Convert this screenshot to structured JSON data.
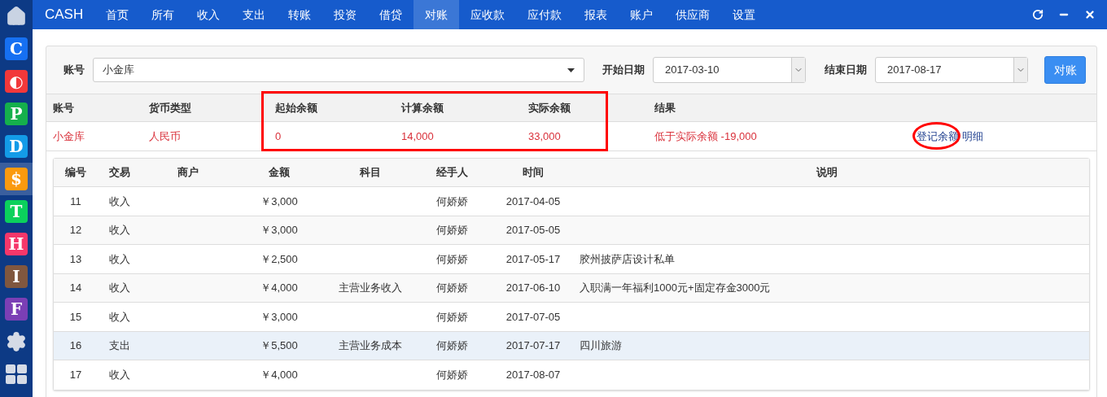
{
  "sidebar": {
    "items": [
      {
        "kind": "home",
        "selected": false
      },
      {
        "kind": "tile",
        "letter": "C",
        "color": "#1670f2",
        "selected": false
      },
      {
        "kind": "tile",
        "letter": "◐",
        "color": "#f2383a",
        "selected": false
      },
      {
        "kind": "tile",
        "letter": "P",
        "color": "#15b04c",
        "selected": false
      },
      {
        "kind": "tile",
        "letter": "D",
        "color": "#139be8",
        "selected": false
      },
      {
        "kind": "tile",
        "letter": "$",
        "color": "#fb9a0e",
        "selected": true
      },
      {
        "kind": "tile",
        "letter": "T",
        "color": "#0bd15c",
        "selected": false
      },
      {
        "kind": "tile",
        "letter": "H",
        "color": "#f5376a",
        "selected": false
      },
      {
        "kind": "tile",
        "letter": "I",
        "color": "#80573f",
        "selected": false
      },
      {
        "kind": "tile",
        "letter": "F",
        "color": "#7b3fb5",
        "selected": false
      },
      {
        "kind": "settings",
        "selected": false
      },
      {
        "kind": "apps",
        "selected": false
      }
    ]
  },
  "topbar": {
    "brand": "CASH",
    "tabs": [
      {
        "label": "首页",
        "selected": false
      },
      {
        "label": "所有",
        "selected": false
      },
      {
        "label": "收入",
        "selected": false
      },
      {
        "label": "支出",
        "selected": false
      },
      {
        "label": "转账",
        "selected": false
      },
      {
        "label": "投资",
        "selected": false
      },
      {
        "label": "借贷",
        "selected": false
      },
      {
        "label": "对账",
        "selected": true
      },
      {
        "label": "应收款",
        "selected": false
      },
      {
        "label": "应付款",
        "selected": false
      },
      {
        "label": "报表",
        "selected": false
      },
      {
        "label": "账户",
        "selected": false
      },
      {
        "label": "供应商",
        "selected": false
      },
      {
        "label": "设置",
        "selected": false
      }
    ]
  },
  "filter": {
    "account_label": "账号",
    "account": "小金库",
    "start_label": "开始日期",
    "start_date": "2017-03-10",
    "end_label": "结束日期",
    "end_date": "2017-08-17",
    "button": "对账"
  },
  "summary": {
    "columns": [
      "账号",
      "货币类型",
      "起始余额",
      "计算余额",
      "实际余额",
      "结果"
    ],
    "row": {
      "account": "小金库",
      "currency": "人民币",
      "start": "0",
      "computed": "14,000",
      "actual": "33,000",
      "result": "低于实际余额 -19,000"
    },
    "links": [
      "登记余额",
      "明细"
    ],
    "annotations": [
      {
        "kind": "rectangle",
        "color": "#ff0000"
      },
      {
        "kind": "ellipse",
        "color": "#ff0000"
      }
    ]
  },
  "table": {
    "columns": [
      "编号",
      "交易",
      "商户",
      "金额",
      "科目",
      "经手人",
      "时间",
      "说明"
    ],
    "rows": [
      {
        "cells": [
          "11",
          "收入",
          "",
          "￥3,000",
          "",
          "何娇娇",
          "2017-04-05",
          ""
        ],
        "selected": false
      },
      {
        "cells": [
          "12",
          "收入",
          "",
          "￥3,000",
          "",
          "何娇娇",
          "2017-05-05",
          ""
        ],
        "selected": false
      },
      {
        "cells": [
          "13",
          "收入",
          "",
          "￥2,500",
          "",
          "何娇娇",
          "2017-05-17",
          "胶州披萨店设计私单"
        ],
        "selected": false
      },
      {
        "cells": [
          "14",
          "收入",
          "",
          "￥4,000",
          "主营业务收入",
          "何娇娇",
          "2017-06-10",
          "入职满一年福利1000元+固定存金3000元"
        ],
        "selected": false
      },
      {
        "cells": [
          "15",
          "收入",
          "",
          "￥3,000",
          "",
          "何娇娇",
          "2017-07-05",
          ""
        ],
        "selected": false
      },
      {
        "cells": [
          "16",
          "支出",
          "",
          "￥5,500",
          "主营业务成本",
          "何娇娇",
          "2017-07-17",
          "四川旅游"
        ],
        "selected": true
      },
      {
        "cells": [
          "17",
          "收入",
          "",
          "￥4,000",
          "",
          "何娇娇",
          "2017-08-07",
          ""
        ],
        "selected": false
      }
    ]
  }
}
